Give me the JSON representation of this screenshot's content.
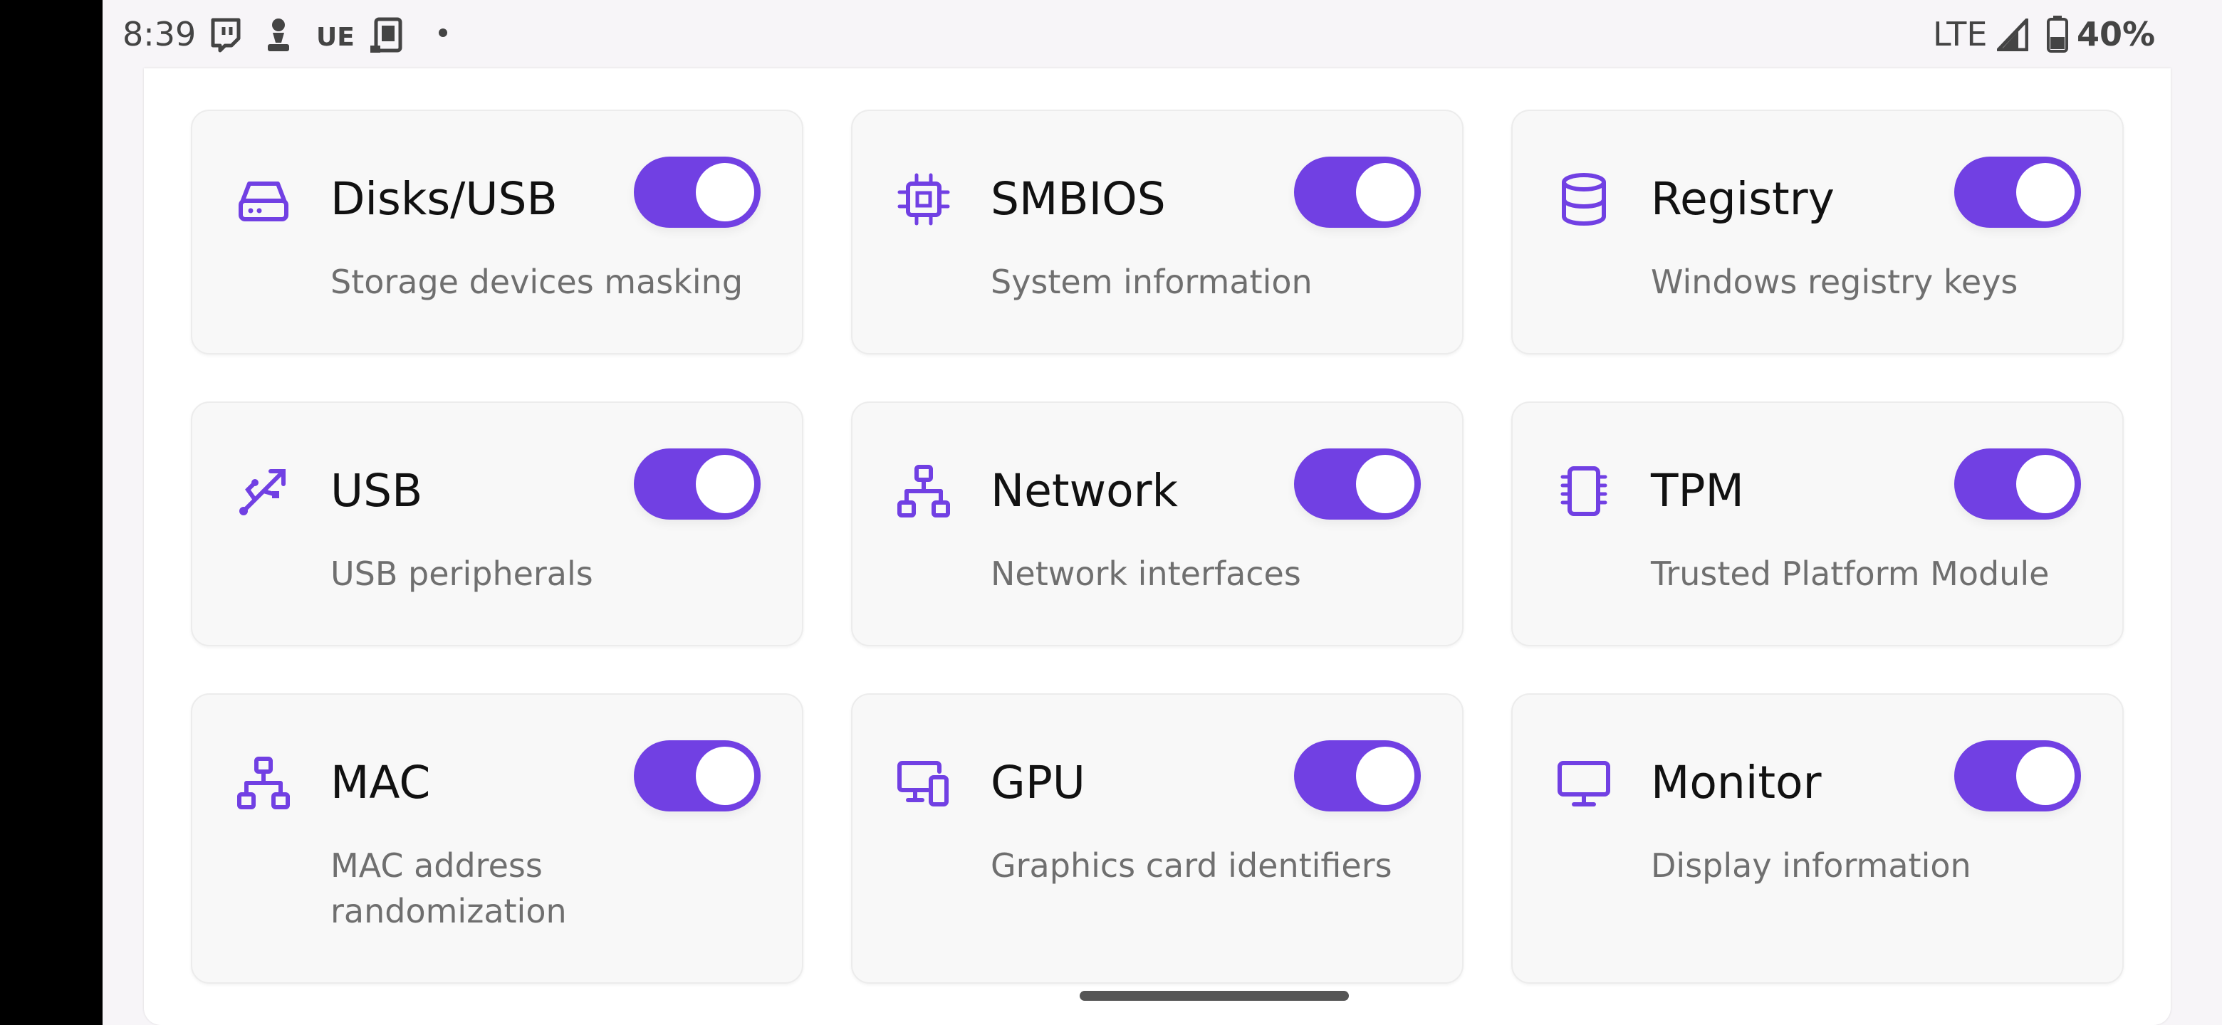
{
  "status_bar": {
    "time": "8:39",
    "carrier_icon_text": "UE",
    "network": "LTE",
    "battery": "40%",
    "notification_icons": [
      "twitch-icon",
      "chess-pawn-icon",
      "ue-icon",
      "phone-icon",
      "dot-icon"
    ],
    "system_icons": [
      "signal-icon",
      "battery-icon"
    ]
  },
  "accent_color": "#7140e3",
  "cards": [
    {
      "icon": "hard-drive-icon",
      "title": "Disks/USB",
      "description": "Storage devices masking",
      "enabled": true
    },
    {
      "icon": "cpu-chip-icon",
      "title": "SMBIOS",
      "description": "System information",
      "enabled": true
    },
    {
      "icon": "database-icon",
      "title": "Registry",
      "description": "Windows registry keys",
      "enabled": true
    },
    {
      "icon": "usb-icon",
      "title": "USB",
      "description": "USB peripherals",
      "enabled": true
    },
    {
      "icon": "network-icon",
      "title": "Network",
      "description": "Network interfaces",
      "enabled": true
    },
    {
      "icon": "tpm-chip-icon",
      "title": "TPM",
      "description": "Trusted Platform Module",
      "enabled": true
    },
    {
      "icon": "mac-network-icon",
      "title": "MAC",
      "description": "MAC address randomization",
      "enabled": true
    },
    {
      "icon": "gpu-devices-icon",
      "title": "GPU",
      "description": "Graphics card identifiers",
      "enabled": true
    },
    {
      "icon": "monitor-icon",
      "title": "Monitor",
      "description": "Display information",
      "enabled": true
    }
  ]
}
